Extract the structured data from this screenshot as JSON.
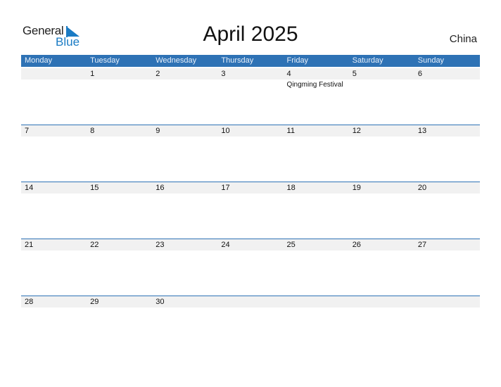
{
  "logo": {
    "general": "General",
    "blue": "Blue"
  },
  "title": "April 2025",
  "country": "China",
  "colors": {
    "header": "#2e72b5",
    "accent": "#1a7bc4",
    "strip": "#f1f1f1"
  },
  "weekdays": [
    "Monday",
    "Tuesday",
    "Wednesday",
    "Thursday",
    "Friday",
    "Saturday",
    "Sunday"
  ],
  "weeks": [
    [
      {
        "d": ""
      },
      {
        "d": "1"
      },
      {
        "d": "2"
      },
      {
        "d": "3"
      },
      {
        "d": "4",
        "event": "Qingming Festival"
      },
      {
        "d": "5"
      },
      {
        "d": "6"
      }
    ],
    [
      {
        "d": "7"
      },
      {
        "d": "8"
      },
      {
        "d": "9"
      },
      {
        "d": "10"
      },
      {
        "d": "11"
      },
      {
        "d": "12"
      },
      {
        "d": "13"
      }
    ],
    [
      {
        "d": "14"
      },
      {
        "d": "15"
      },
      {
        "d": "16"
      },
      {
        "d": "17"
      },
      {
        "d": "18"
      },
      {
        "d": "19"
      },
      {
        "d": "20"
      }
    ],
    [
      {
        "d": "21"
      },
      {
        "d": "22"
      },
      {
        "d": "23"
      },
      {
        "d": "24"
      },
      {
        "d": "25"
      },
      {
        "d": "26"
      },
      {
        "d": "27"
      }
    ],
    [
      {
        "d": "28"
      },
      {
        "d": "29"
      },
      {
        "d": "30"
      },
      {
        "d": ""
      },
      {
        "d": ""
      },
      {
        "d": ""
      },
      {
        "d": ""
      }
    ]
  ]
}
